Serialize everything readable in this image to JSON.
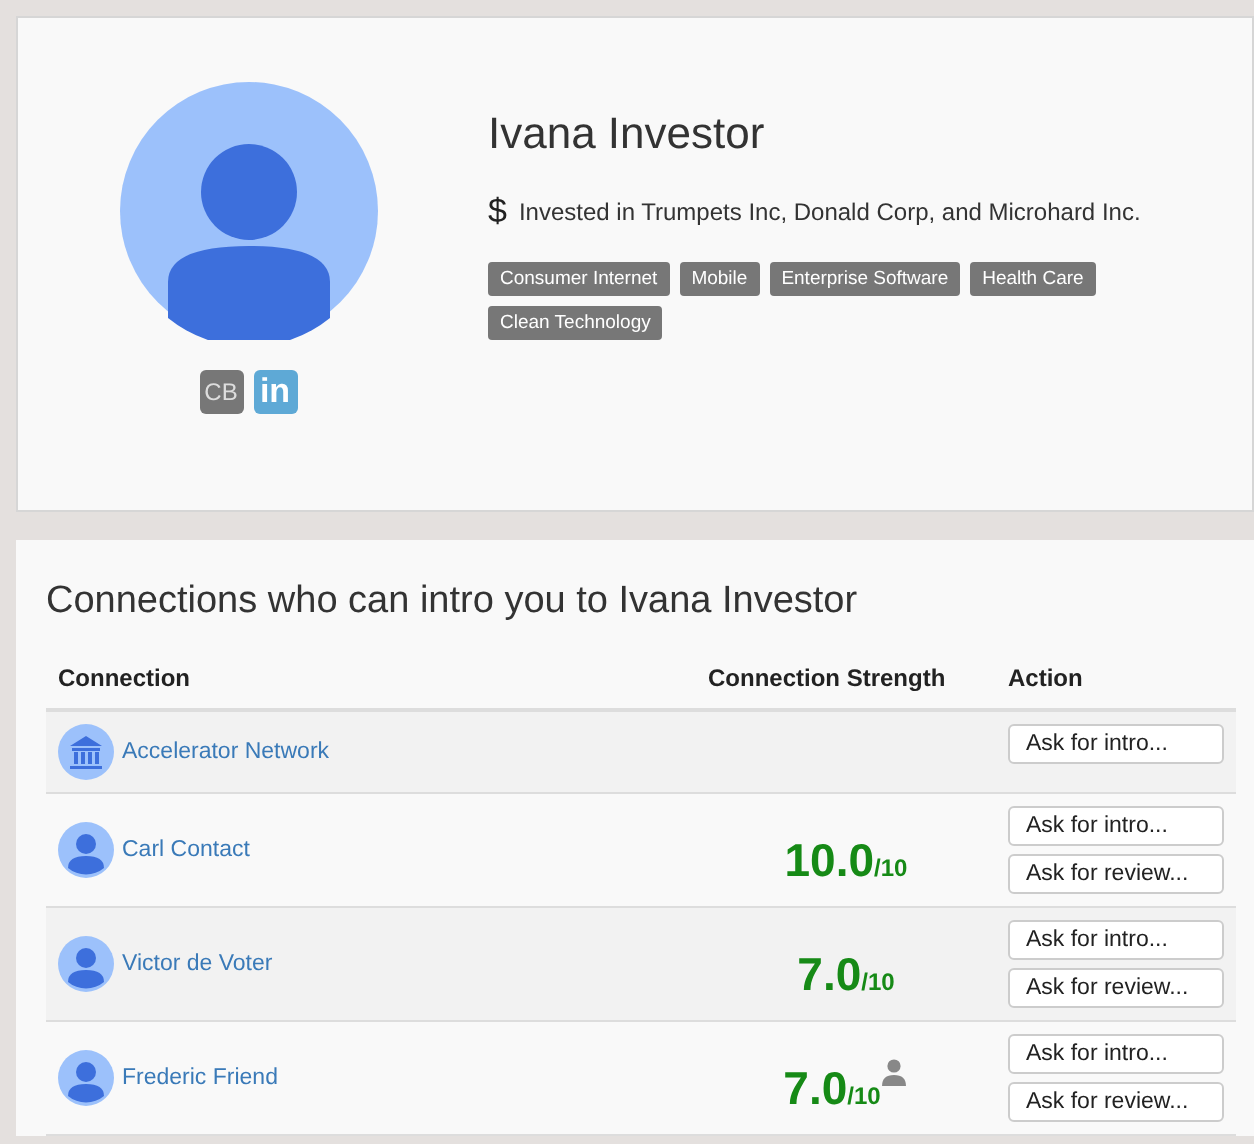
{
  "profile": {
    "name": "Ivana Investor",
    "investments_icon": "$",
    "investments": "Invested in Trumpets Inc, Donald Corp, and Microhard Inc.",
    "tags": [
      "Consumer Internet",
      "Mobile",
      "Enterprise Software",
      "Health Care",
      "Clean Technology"
    ],
    "links": [
      {
        "kind": "crunchbase",
        "text": "CB"
      },
      {
        "kind": "linkedin",
        "text": "in"
      }
    ]
  },
  "connections": {
    "title": "Connections who can intro you to Ivana Investor",
    "columns": [
      "Connection",
      "Connection Strength",
      "Action"
    ],
    "rows": [
      {
        "kind": "organization",
        "name": "Accelerator Network",
        "buttons": [
          "Ask for intro..."
        ]
      },
      {
        "kind": "person",
        "name": "Carl Contact",
        "score": "10.0",
        "scale": "/10",
        "person_mark": false,
        "buttons": [
          "Ask for intro...",
          "Ask for review..."
        ]
      },
      {
        "kind": "person",
        "name": "Victor de Voter",
        "score": "7.0",
        "scale": "/10",
        "person_mark": false,
        "buttons": [
          "Ask for intro...",
          "Ask for review..."
        ]
      },
      {
        "kind": "person",
        "name": "Frederic Friend",
        "score": "7.0",
        "scale": "/10",
        "person_mark": true,
        "buttons": [
          "Ask for intro...",
          "Ask for review..."
        ]
      }
    ]
  }
}
